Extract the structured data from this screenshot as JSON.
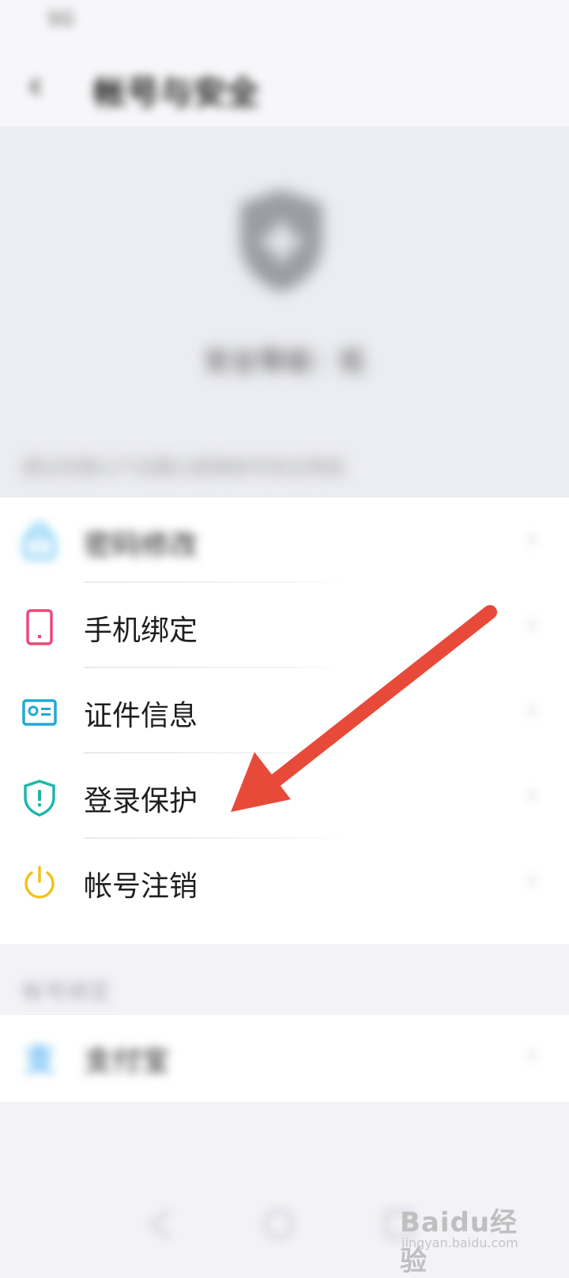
{
  "status_bar": {
    "left_text": "5G",
    "right_text": ""
  },
  "header": {
    "title": "帐号与安全"
  },
  "hero": {
    "level_text": "安全等级：低",
    "tip_text": "建议完善以下设置以提高帐号安全等级"
  },
  "list": [
    {
      "label": "密码修改",
      "value": "",
      "icon": "lock-icon",
      "color": "#49b8f0"
    },
    {
      "label": "手机绑定",
      "value": "",
      "icon": "phone-icon",
      "color": "#e84a78"
    },
    {
      "label": "证件信息",
      "value": "",
      "icon": "id-card-icon",
      "color": "#22a8d6"
    },
    {
      "label": "登录保护",
      "value": "",
      "icon": "shield-exclamation-icon",
      "color": "#20b6a8"
    },
    {
      "label": "帐号注销",
      "value": "",
      "icon": "power-icon",
      "color": "#f2c21a"
    }
  ],
  "bind_section": {
    "title": "帐号绑定"
  },
  "bind_list": [
    {
      "label": "支付宝",
      "value": "",
      "icon": "alipay-icon",
      "color": "#1f9cf0"
    }
  ],
  "watermark": {
    "text": "Baidu经验",
    "sub": "jingyan.baidu.com"
  },
  "colors": {
    "arrow": "#e84a3a",
    "link": "#3d6bff",
    "background": "#f2f2f7"
  }
}
